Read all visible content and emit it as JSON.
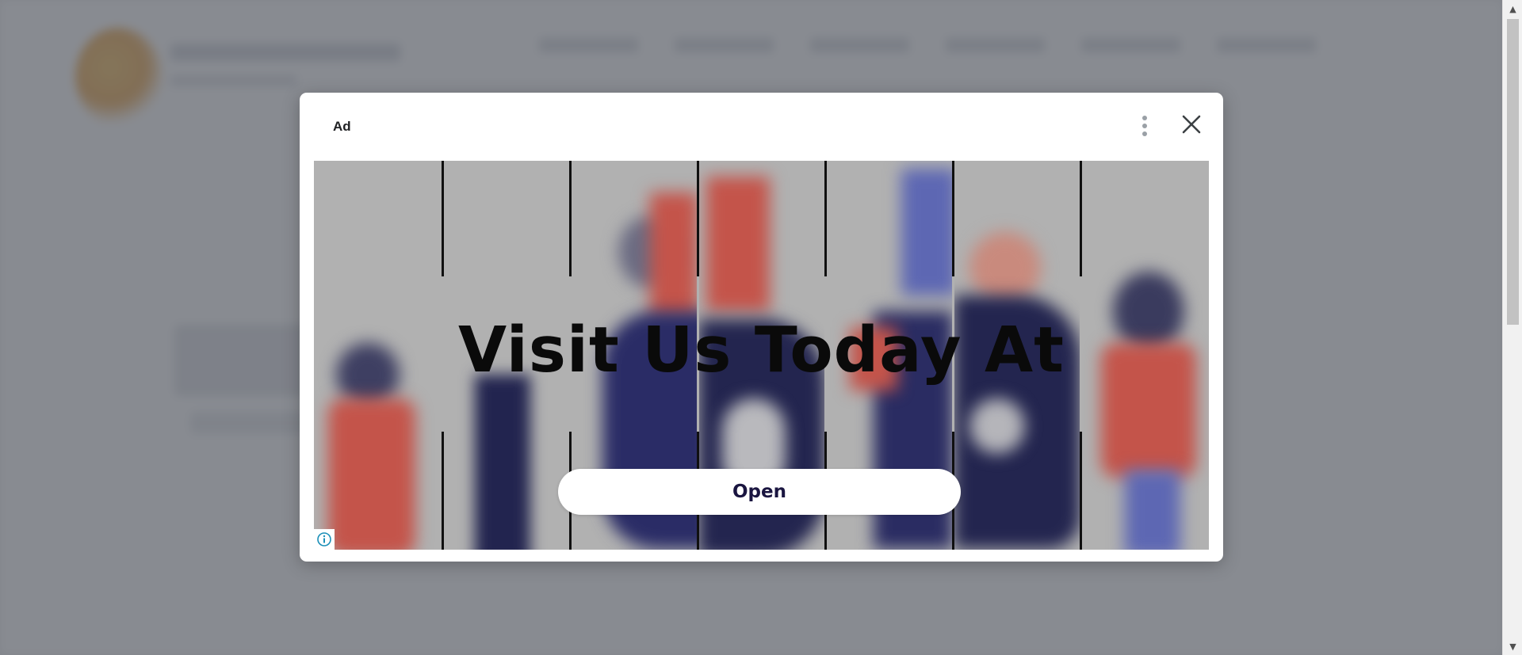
{
  "ad": {
    "label": "Ad",
    "headline": "Visit Us Today At",
    "cta_label": "Open",
    "menu_icon": "more-vert-icon",
    "close_icon": "close-icon",
    "info_icon": "info-icon"
  },
  "colors": {
    "overlay": "#5a5e66",
    "dialog_bg": "#ffffff",
    "headline": "#0a0a0a",
    "cta_text": "#1a1540",
    "creative_bg": "#b1b1b1",
    "brand_navy": "#1d1f4a",
    "info_accent": "#1a8fb8"
  }
}
